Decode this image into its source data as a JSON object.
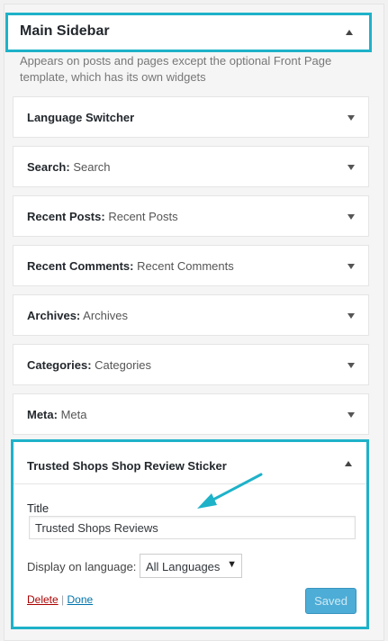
{
  "sidebar": {
    "title": "Main Sidebar",
    "description": "Appears on posts and pages except the optional Front Page template, which has its own widgets"
  },
  "widgets": [
    {
      "name": "Language Switcher",
      "instance": ""
    },
    {
      "name": "Search:",
      "instance": "Search"
    },
    {
      "name": "Recent Posts:",
      "instance": "Recent Posts"
    },
    {
      "name": "Recent Comments:",
      "instance": "Recent Comments"
    },
    {
      "name": "Archives:",
      "instance": "Archives"
    },
    {
      "name": "Categories:",
      "instance": "Categories"
    },
    {
      "name": "Meta:",
      "instance": "Meta"
    }
  ],
  "expanded_widget": {
    "name": "Trusted Shops Shop Review Sticker",
    "title_label": "Title",
    "title_value": "Trusted Shops Reviews",
    "language_label": "Display on language:",
    "language_selected": "All Languages",
    "delete_label": "Delete",
    "separator": "|",
    "done_label": "Done",
    "saved_label": "Saved"
  },
  "colors": {
    "highlight": "#1eb2c9",
    "primary_button": "#4dadd6",
    "delete_link": "#aa0000",
    "done_link": "#0073aa"
  },
  "icons": {
    "collapse": "triangle-up",
    "expand": "triangle-down",
    "select": "caret-down",
    "annotation": "pointer-arrow"
  }
}
